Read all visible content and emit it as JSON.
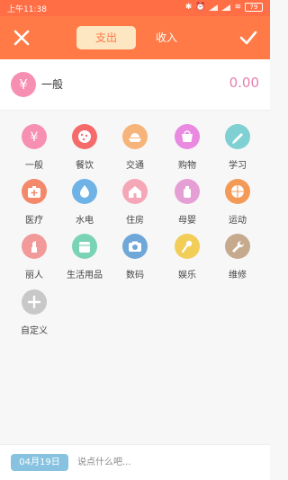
{
  "status_bar": {
    "time": "上午11:38",
    "battery": "79"
  },
  "header": {
    "tabs": [
      {
        "label": "支出",
        "active": true
      },
      {
        "label": "收入",
        "active": false
      }
    ],
    "close_icon": "close-icon",
    "confirm_icon": "check-icon"
  },
  "summary": {
    "category": "一般",
    "symbol": "¥",
    "amount": "0.00"
  },
  "categories": [
    {
      "label": "一般",
      "icon": "yen-icon",
      "color": "#f78fb3"
    },
    {
      "label": "餐饮",
      "icon": "cookie-icon",
      "color": "#f56b6b"
    },
    {
      "label": "交通",
      "icon": "ship-icon",
      "color": "#f6b47a"
    },
    {
      "label": "购物",
      "icon": "shopping-icon",
      "color": "#e98ae0"
    },
    {
      "label": "学习",
      "icon": "pencil-icon",
      "color": "#7fd0d2"
    },
    {
      "label": "医疗",
      "icon": "medkit-icon",
      "color": "#f4886a"
    },
    {
      "label": "水电",
      "icon": "water-drop-icon",
      "color": "#6fb2e6"
    },
    {
      "label": "住房",
      "icon": "house-icon",
      "color": "#f5a7b7"
    },
    {
      "label": "母婴",
      "icon": "baby-bottle-icon",
      "color": "#e69fd5"
    },
    {
      "label": "运动",
      "icon": "ball-icon",
      "color": "#f39a57"
    },
    {
      "label": "丽人",
      "icon": "lipstick-icon",
      "color": "#f29a9a"
    },
    {
      "label": "生活用品",
      "icon": "towel-icon",
      "color": "#7bd3b6"
    },
    {
      "label": "数码",
      "icon": "camera-icon",
      "color": "#6fa7d8"
    },
    {
      "label": "娱乐",
      "icon": "microphone-icon",
      "color": "#f2cd57"
    },
    {
      "label": "维修",
      "icon": "wrench-icon",
      "color": "#c6aa8d"
    },
    {
      "label": "自定义",
      "icon": "plus-icon",
      "color": "#c8c8c8"
    }
  ],
  "footer": {
    "date": "04月19日",
    "note_placeholder": "说点什么吧..."
  }
}
